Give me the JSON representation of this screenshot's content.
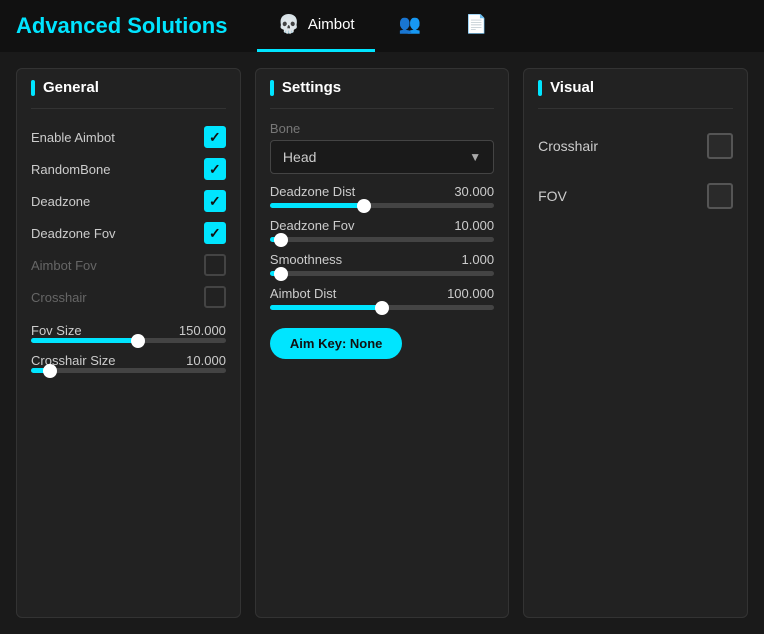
{
  "app": {
    "title": "Advanced Solutions"
  },
  "header": {
    "tabs": [
      {
        "id": "aimbot",
        "label": "Aimbot",
        "icon": "💀",
        "active": true
      },
      {
        "id": "players",
        "label": "",
        "icon": "👥",
        "active": false
      },
      {
        "id": "settings",
        "label": "",
        "icon": "📄",
        "active": false
      }
    ]
  },
  "general_panel": {
    "heading": "General",
    "items": [
      {
        "label": "Enable Aimbot",
        "checked": true,
        "disabled": false
      },
      {
        "label": "RandomBone",
        "checked": true,
        "disabled": false
      },
      {
        "label": "Deadzone",
        "checked": true,
        "disabled": false
      },
      {
        "label": "Deadzone Fov",
        "checked": true,
        "disabled": false
      },
      {
        "label": "Aimbot Fov",
        "checked": false,
        "disabled": true
      },
      {
        "label": "Crosshair",
        "checked": false,
        "disabled": true
      }
    ],
    "fov_size": {
      "label": "Fov Size",
      "value": "150.000",
      "fill_percent": 55
    },
    "crosshair_size": {
      "label": "Crosshair Size",
      "value": "10.000",
      "fill_percent": 10
    }
  },
  "settings_panel": {
    "heading": "Settings",
    "bone_label": "Bone",
    "bone_value": "Head",
    "sliders": [
      {
        "label": "Deadzone Dist",
        "value": "30.000",
        "fill_percent": 42
      },
      {
        "label": "Deadzone Fov",
        "value": "10.000",
        "fill_percent": 5
      },
      {
        "label": "Smoothness",
        "value": "1.000",
        "fill_percent": 5
      },
      {
        "label": "Aimbot Dist",
        "value": "100.000",
        "fill_percent": 50
      }
    ],
    "aim_key_label": "Aim Key: None"
  },
  "visual_panel": {
    "heading": "Visual",
    "items": [
      {
        "label": "Crosshair",
        "checked": false
      },
      {
        "label": "FOV",
        "checked": false
      }
    ]
  }
}
